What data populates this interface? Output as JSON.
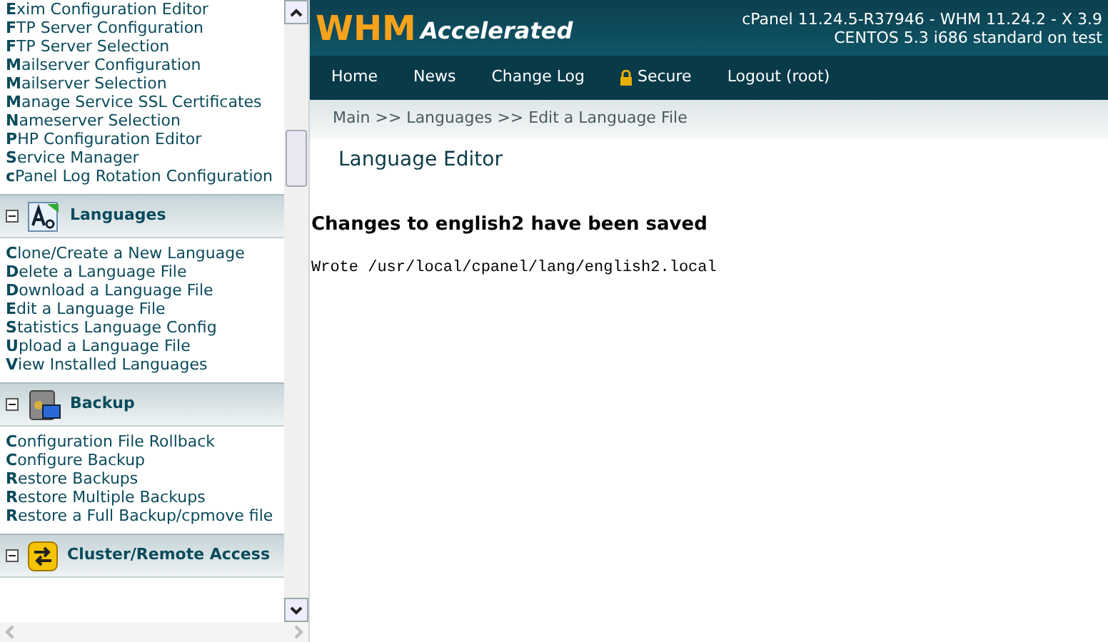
{
  "sidebar": {
    "top_links": [
      "**E**xim Configuration Editor",
      "**F**TP Server Configuration",
      "**F**TP Server Selection",
      "**M**ailserver Configuration",
      "**M**ailserver Selection",
      "**M**anage Service SSL Certificates",
      "**N**ameserver Selection",
      "**P**HP Configuration Editor",
      "**S**ervice Manager",
      "**c**Panel Log Rotation Configuration"
    ],
    "sections": [
      {
        "title": "Languages",
        "kind": "languages",
        "expanded": true,
        "links": [
          "**C**lone/Create a New Language",
          "**D**elete a Language File",
          "**D**ownload a Language File",
          "**E**dit a Language File",
          "**S**tatistics Language Config",
          "**U**pload a Language File",
          "**V**iew Installed Languages"
        ]
      },
      {
        "title": "Backup",
        "kind": "backup",
        "expanded": true,
        "links": [
          "**C**onfiguration File Rollback",
          "**C**onfigure Backup",
          "**R**estore Backups",
          "**R**estore Multiple Backups",
          "**R**estore a Full Backup/cpmove file"
        ]
      },
      {
        "title": "Cluster/Remote Access",
        "kind": "cluster",
        "expanded": true
      }
    ]
  },
  "header": {
    "logo_main": "WHM",
    "logo_sub": "Accelerated",
    "version_line": "cPanel 11.24.5-R37946 - WHM 11.24.2 - X 3.9",
    "os_line": "CENTOS 5.3 i686 standard on test"
  },
  "nav": [
    {
      "label": "Home",
      "kind": "plain"
    },
    {
      "label": "News",
      "kind": "plain"
    },
    {
      "label": "Change Log",
      "kind": "plain"
    },
    {
      "label": "Secure",
      "kind": "lock"
    },
    {
      "label": "Logout (root)",
      "kind": "plain"
    }
  ],
  "breadcrumb": "Main >> Languages >> Edit a Language File",
  "page_title": "Language Editor",
  "message": "Changes to english2 have been saved",
  "output": "Wrote /usr/local/cpanel/lang/english2.local"
}
